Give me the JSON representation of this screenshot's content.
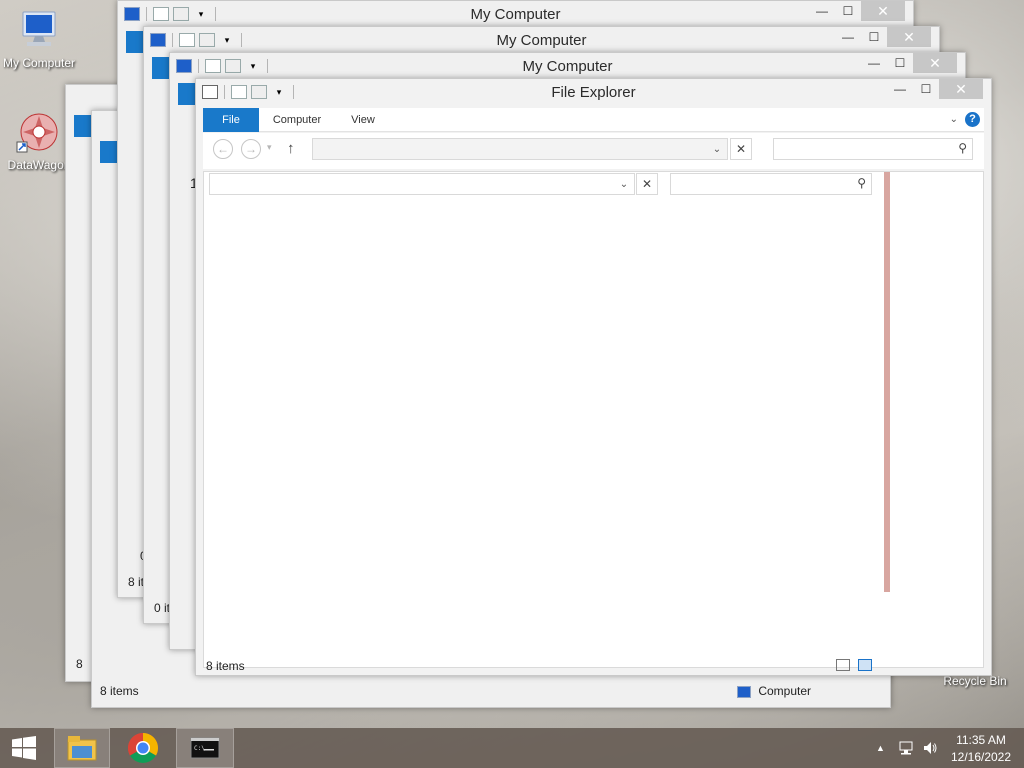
{
  "desktop": {
    "icons": [
      {
        "label": "My Computer"
      },
      {
        "label": "DataWagon"
      },
      {
        "label": "Recycle Bin"
      }
    ]
  },
  "windows": [
    {
      "title": "My Computer",
      "status_items": "8 items"
    },
    {
      "title": "My Computer",
      "status_items": "8 items"
    },
    {
      "title": "My Computer",
      "status_items": "0 it"
    },
    {
      "title": "File Explorer",
      "status_items": "8 items"
    }
  ],
  "explorer": {
    "title": "File Explorer",
    "tabs": [
      "File",
      "Computer",
      "View"
    ],
    "address_value": "",
    "search_placeholder": "",
    "status_items": "8 items",
    "location": "Computer"
  },
  "background_labels": {
    "partial_left_1": "8",
    "partial_left_2": "8 it",
    "partial_left_3": "0",
    "partial_comp": "omp",
    "partial_1": "1"
  },
  "taskbar": {
    "time": "11:35 AM",
    "date": "12/16/2022",
    "apps": [
      "start",
      "file-explorer",
      "chrome",
      "command-prompt"
    ]
  },
  "colors": {
    "accent": "#1979ca",
    "help": "#1a73c9"
  }
}
